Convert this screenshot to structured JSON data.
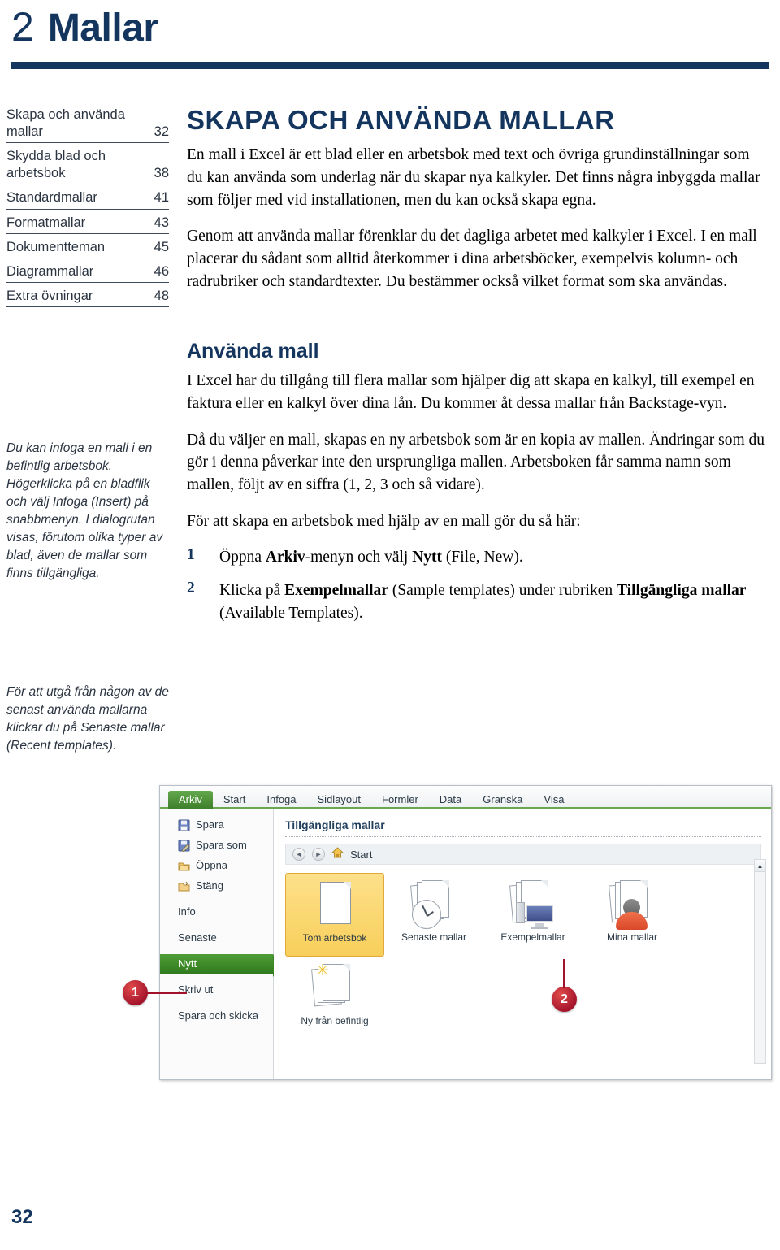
{
  "chapter": {
    "number": "2",
    "title": "Mallar"
  },
  "toc": {
    "items": [
      {
        "label": "Skapa och använda mallar",
        "page": "32"
      },
      {
        "label": "Skydda blad och arbetsbok",
        "page": "38"
      },
      {
        "label": "Standardmallar",
        "page": "41"
      },
      {
        "label": "Formatmallar",
        "page": "43"
      },
      {
        "label": "Dokumentteman",
        "page": "45"
      },
      {
        "label": "Diagrammallar",
        "page": "46"
      },
      {
        "label": "Extra övningar",
        "page": "48"
      }
    ]
  },
  "margin_notes": {
    "note1": "Du kan infoga en mall i en befintlig arbetsbok. Högerklicka på en bladflik och välj Infoga (Insert) på snabbmenyn. I dialogrutan visas, förutom olika typer av blad, även de mallar som finns tillgängliga.",
    "note2": "För att utgå från någon av de senast använda mallarna klickar du på Senaste mallar (Recent templates)."
  },
  "main": {
    "heading": "SKAPA OCH ANVÄNDA MALLAR",
    "paragraph1": "En mall i Excel är ett blad eller en arbetsbok med text och övriga grundinställningar som du kan använda som underlag när du skapar nya kalkyler. Det finns några inbyggda mallar som följer med vid installationen, men du kan också skapa egna.",
    "paragraph2": "Genom att använda mallar förenklar du det dagliga arbetet med kalkyler i Excel. I en mall placerar du sådant som alltid återkommer i dina arbetsböcker, exempelvis kolumn- och radrubriker och standardtexter. Du bestämmer också vilket format som ska användas.",
    "subheading": "Använda mall",
    "paragraph3": "I Excel har du tillgång till flera mallar som hjälper dig att skapa en kalkyl, till exempel en faktura eller en kalkyl över dina lån. Du kommer åt dessa mallar från Backstage-vyn.",
    "paragraph4": "Då du väljer en mall, skapas en ny arbetsbok som är en kopia av mallen. Ändringar som du gör i denna påverkar inte den ursprungliga mallen. Arbetsboken får samma namn som mallen, följt av en siffra (1, 2, 3 och så vidare).",
    "paragraph5": "För att skapa en arbetsbok med hjälp av en mall gör du så här:"
  },
  "steps": [
    {
      "number": "1",
      "text_parts": [
        {
          "text": "Öppna ",
          "bold": false
        },
        {
          "text": "Arkiv",
          "bold": true
        },
        {
          "text": "-menyn och välj ",
          "bold": false
        },
        {
          "text": "Nytt",
          "bold": true
        },
        {
          "text": " (File, New).",
          "bold": false
        }
      ]
    },
    {
      "number": "2",
      "text_parts": [
        {
          "text": "Klicka på ",
          "bold": false
        },
        {
          "text": "Exempelmallar",
          "bold": true
        },
        {
          "text": " (Sample templates) under rubriken ",
          "bold": false
        },
        {
          "text": "Tillgängliga mallar",
          "bold": true
        },
        {
          "text": " (Available Templates).",
          "bold": false
        }
      ]
    }
  ],
  "screenshot": {
    "ribbon_tabs": [
      {
        "label": "Arkiv",
        "active": true
      },
      {
        "label": "Start",
        "active": false
      },
      {
        "label": "Infoga",
        "active": false
      },
      {
        "label": "Sidlayout",
        "active": false
      },
      {
        "label": "Formler",
        "active": false
      },
      {
        "label": "Data",
        "active": false
      },
      {
        "label": "Granska",
        "active": false
      },
      {
        "label": "Visa",
        "active": false
      }
    ],
    "backstage_items": [
      {
        "label": "Spara",
        "icon": "save-icon",
        "active": false,
        "gap": false
      },
      {
        "label": "Spara som",
        "icon": "save-as-icon",
        "active": false,
        "gap": false
      },
      {
        "label": "Öppna",
        "icon": "open-folder-icon",
        "active": false,
        "gap": false
      },
      {
        "label": "Stäng",
        "icon": "close-folder-icon",
        "active": false,
        "gap": false
      },
      {
        "label": "Info",
        "icon": "",
        "active": false,
        "gap": true
      },
      {
        "label": "Senaste",
        "icon": "",
        "active": false,
        "gap": true
      },
      {
        "label": "Nytt",
        "icon": "",
        "active": true,
        "gap": true
      },
      {
        "label": "Skriv ut",
        "icon": "",
        "active": false,
        "gap": true
      },
      {
        "label": "Spara och skicka",
        "icon": "",
        "active": false,
        "gap": true
      }
    ],
    "gallery_title": "Tillgängliga mallar",
    "nav": {
      "back": "◄",
      "forward": "►",
      "home_label": "Start"
    },
    "tiles": [
      {
        "label": "Tom arbetsbok",
        "art": "blank-document",
        "selected": true
      },
      {
        "label": "Senaste mallar",
        "art": "clock-documents",
        "selected": false
      },
      {
        "label": "Exempelmallar",
        "art": "computer-documents",
        "selected": false
      },
      {
        "label": "Mina mallar",
        "art": "person-documents",
        "selected": false
      },
      {
        "label": "Ny från befintlig",
        "art": "sparkle-documents",
        "selected": false
      }
    ],
    "scroll_up": "▲"
  },
  "callouts": [
    {
      "number": "1"
    },
    {
      "number": "2"
    }
  ],
  "footer": {
    "page_number": "32"
  },
  "colors": {
    "navy": "#13355e",
    "excel_green": "#3e7f2b",
    "callout_red": "#a2112a",
    "tile_selected": "#f8cf5b"
  }
}
